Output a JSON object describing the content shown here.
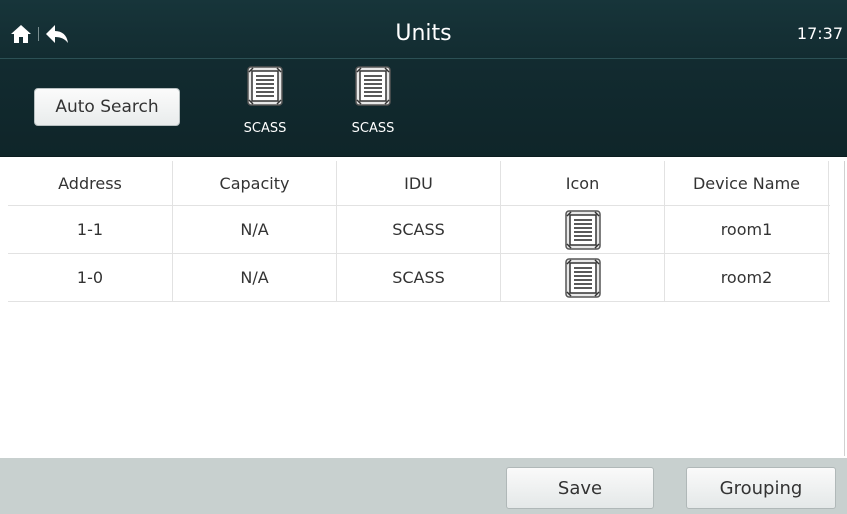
{
  "header": {
    "title": "Units",
    "time": "17:37",
    "home_icon": "home-icon",
    "back_icon": "back-arrow-icon"
  },
  "toolbar": {
    "auto_search_label": "Auto Search",
    "units": [
      {
        "label": "SCASS",
        "icon": "cassette-unit-icon"
      },
      {
        "label": "SCASS",
        "icon": "cassette-unit-icon"
      }
    ]
  },
  "table": {
    "columns": [
      "Address",
      "Capacity",
      "IDU",
      "Icon",
      "Device Name"
    ],
    "rows": [
      {
        "address": "1-1",
        "capacity": "N/A",
        "idu": "SCASS",
        "icon": "cassette-unit-icon",
        "device_name": "room1"
      },
      {
        "address": "1-0",
        "capacity": "N/A",
        "idu": "SCASS",
        "icon": "cassette-unit-icon",
        "device_name": "room2"
      }
    ]
  },
  "footer": {
    "save_label": "Save",
    "grouping_label": "Grouping"
  },
  "colors": {
    "header_bg": "#122b30",
    "footer_bg": "#c8d0cf",
    "button_bg": "#f0f2f2"
  }
}
